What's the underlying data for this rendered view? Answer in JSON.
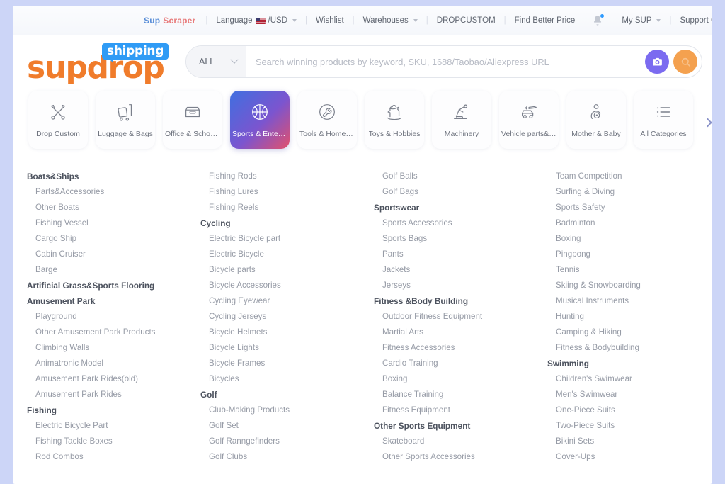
{
  "topbar": {
    "brand_part1": "Sup",
    "brand_part2": "Scraper",
    "language": "Language",
    "currency": "/USD",
    "wishlist": "Wishlist",
    "warehouses": "Warehouses",
    "dropcustom": "DROPCUSTOM",
    "find_better_price": "Find Better Price",
    "my_sup": "My SUP",
    "support_center": "Support Center",
    "notification_icon": "bell-icon",
    "flag_icon": "us-flag-icon"
  },
  "header": {
    "logo_word": "supdrop",
    "logo_badge": "shipping",
    "search_category": "ALL",
    "search_placeholder": "Search winning products by keyword, SKU, 1688/Taobao/Aliexpress URL",
    "search_value": "",
    "camera_icon": "camera-icon",
    "search_icon": "search-icon"
  },
  "tiles": [
    {
      "label": "Drop Custom",
      "icon": "scissors-pen-icon",
      "active": false
    },
    {
      "label": "Luggage & Bags",
      "icon": "luggage-cart-icon",
      "active": false
    },
    {
      "label": "Office & School ...",
      "icon": "file-drawer-icon",
      "active": false
    },
    {
      "label": "Sports & Entert...",
      "icon": "basketball-icon",
      "active": true
    },
    {
      "label": "Tools & Home I...",
      "icon": "wrench-circle-icon",
      "active": false
    },
    {
      "label": "Toys & Hobbies",
      "icon": "rocking-horse-icon",
      "active": false
    },
    {
      "label": "Machinery",
      "icon": "robot-arm-icon",
      "active": false
    },
    {
      "label": "Vehicle parts&A...",
      "icon": "car-wrench-icon",
      "active": false
    },
    {
      "label": "Mother & Baby",
      "icon": "mother-baby-icon",
      "active": false
    },
    {
      "label": "All Categories",
      "icon": "list-icon",
      "active": false
    }
  ],
  "carousel": {
    "prev_icon": "chevron-left-icon",
    "next_icon": "chevron-right-icon"
  },
  "mega_menu": {
    "columns": [
      [
        {
          "type": "head",
          "label": "Boats&Ships"
        },
        {
          "type": "item",
          "label": "Parts&Accessories"
        },
        {
          "type": "item",
          "label": "Other Boats"
        },
        {
          "type": "item",
          "label": "Fishing Vessel"
        },
        {
          "type": "item",
          "label": "Cargo Ship"
        },
        {
          "type": "item",
          "label": "Cabin Cruiser"
        },
        {
          "type": "item",
          "label": "Barge"
        },
        {
          "type": "head",
          "label": "Artificial Grass&Sports Flooring"
        },
        {
          "type": "head",
          "label": "Amusement Park"
        },
        {
          "type": "item",
          "label": "Playground"
        },
        {
          "type": "item",
          "label": "Other Amusement Park Products"
        },
        {
          "type": "item",
          "label": "Climbing Walls"
        },
        {
          "type": "item",
          "label": "Animatronic Model"
        },
        {
          "type": "item",
          "label": "Amusement Park Rides(old)"
        },
        {
          "type": "item",
          "label": "Amusement Park Rides"
        },
        {
          "type": "head",
          "label": "Fishing"
        },
        {
          "type": "item",
          "label": "Electric Bicycle Part"
        },
        {
          "type": "item",
          "label": "Fishing Tackle Boxes"
        },
        {
          "type": "item",
          "label": "Rod Combos"
        }
      ],
      [
        {
          "type": "item",
          "label": "Fishing Rods"
        },
        {
          "type": "item",
          "label": "Fishing Lures"
        },
        {
          "type": "item",
          "label": "Fishing Reels"
        },
        {
          "type": "head",
          "label": "Cycling"
        },
        {
          "type": "item",
          "label": "Electric Bicycle part"
        },
        {
          "type": "item",
          "label": "Electric Bicycle"
        },
        {
          "type": "item",
          "label": "Bicycle parts"
        },
        {
          "type": "item",
          "label": "Bicycle Accessories"
        },
        {
          "type": "item",
          "label": "Cycling Eyewear"
        },
        {
          "type": "item",
          "label": "Cycling Jerseys"
        },
        {
          "type": "item",
          "label": "Bicycle Helmets"
        },
        {
          "type": "item",
          "label": "Bicycle Lights"
        },
        {
          "type": "item",
          "label": "Bicycle Frames"
        },
        {
          "type": "item",
          "label": "Bicycles"
        },
        {
          "type": "head",
          "label": "Golf"
        },
        {
          "type": "item",
          "label": "Club-Making Products"
        },
        {
          "type": "item",
          "label": "Golf Set"
        },
        {
          "type": "item",
          "label": "Golf Ranngefinders"
        },
        {
          "type": "item",
          "label": "Golf Clubs"
        }
      ],
      [
        {
          "type": "item",
          "label": "Golf Balls"
        },
        {
          "type": "item",
          "label": "Golf Bags"
        },
        {
          "type": "head",
          "label": "Sportswear"
        },
        {
          "type": "item",
          "label": "Sports Accessories"
        },
        {
          "type": "item",
          "label": "Sports Bags"
        },
        {
          "type": "item",
          "label": "Pants"
        },
        {
          "type": "item",
          "label": "Jackets"
        },
        {
          "type": "item",
          "label": "Jerseys"
        },
        {
          "type": "head",
          "label": "Fitness &Body Building"
        },
        {
          "type": "item",
          "label": "Outdoor Fitness Equipment"
        },
        {
          "type": "item",
          "label": "Martial Arts"
        },
        {
          "type": "item",
          "label": "Fitness Accessories"
        },
        {
          "type": "item",
          "label": "Cardio Training"
        },
        {
          "type": "item",
          "label": "Boxing"
        },
        {
          "type": "item",
          "label": "Balance Training"
        },
        {
          "type": "item",
          "label": "Fitness Equipment"
        },
        {
          "type": "head",
          "label": "Other Sports Equipment"
        },
        {
          "type": "item",
          "label": "Skateboard"
        },
        {
          "type": "item",
          "label": "Other Sports Accessories"
        }
      ],
      [
        {
          "type": "item",
          "label": "Team Competition"
        },
        {
          "type": "item",
          "label": "Surfing & Diving"
        },
        {
          "type": "item",
          "label": "Sports Safety"
        },
        {
          "type": "item",
          "label": "Badminton"
        },
        {
          "type": "item",
          "label": "Boxing"
        },
        {
          "type": "item",
          "label": "Pingpong"
        },
        {
          "type": "item",
          "label": "Tennis"
        },
        {
          "type": "item",
          "label": "Skiing & Snowboarding"
        },
        {
          "type": "item",
          "label": "Musical Instruments"
        },
        {
          "type": "item",
          "label": "Hunting"
        },
        {
          "type": "item",
          "label": "Camping & Hiking"
        },
        {
          "type": "item",
          "label": "Fitness & Bodybuilding"
        },
        {
          "type": "head",
          "label": "Swimming"
        },
        {
          "type": "item",
          "label": "Children's Swimwear"
        },
        {
          "type": "item",
          "label": "Men's Swimwear"
        },
        {
          "type": "item",
          "label": "One-Piece Suits"
        },
        {
          "type": "item",
          "label": "Two-Piece Suits"
        },
        {
          "type": "item",
          "label": "Bikini Sets"
        },
        {
          "type": "item",
          "label": "Cover-Ups"
        }
      ]
    ]
  },
  "colors": {
    "page_bg": "#ccd5f7",
    "logo_orange": "#f07c2b",
    "badge_blue": "#2f9bf5",
    "camera_purple": "#7b6bf0",
    "search_orange": "#f4a14f",
    "active_tile_gradient_start": "#3f6fe0",
    "active_tile_gradient_end": "#e2506c"
  }
}
